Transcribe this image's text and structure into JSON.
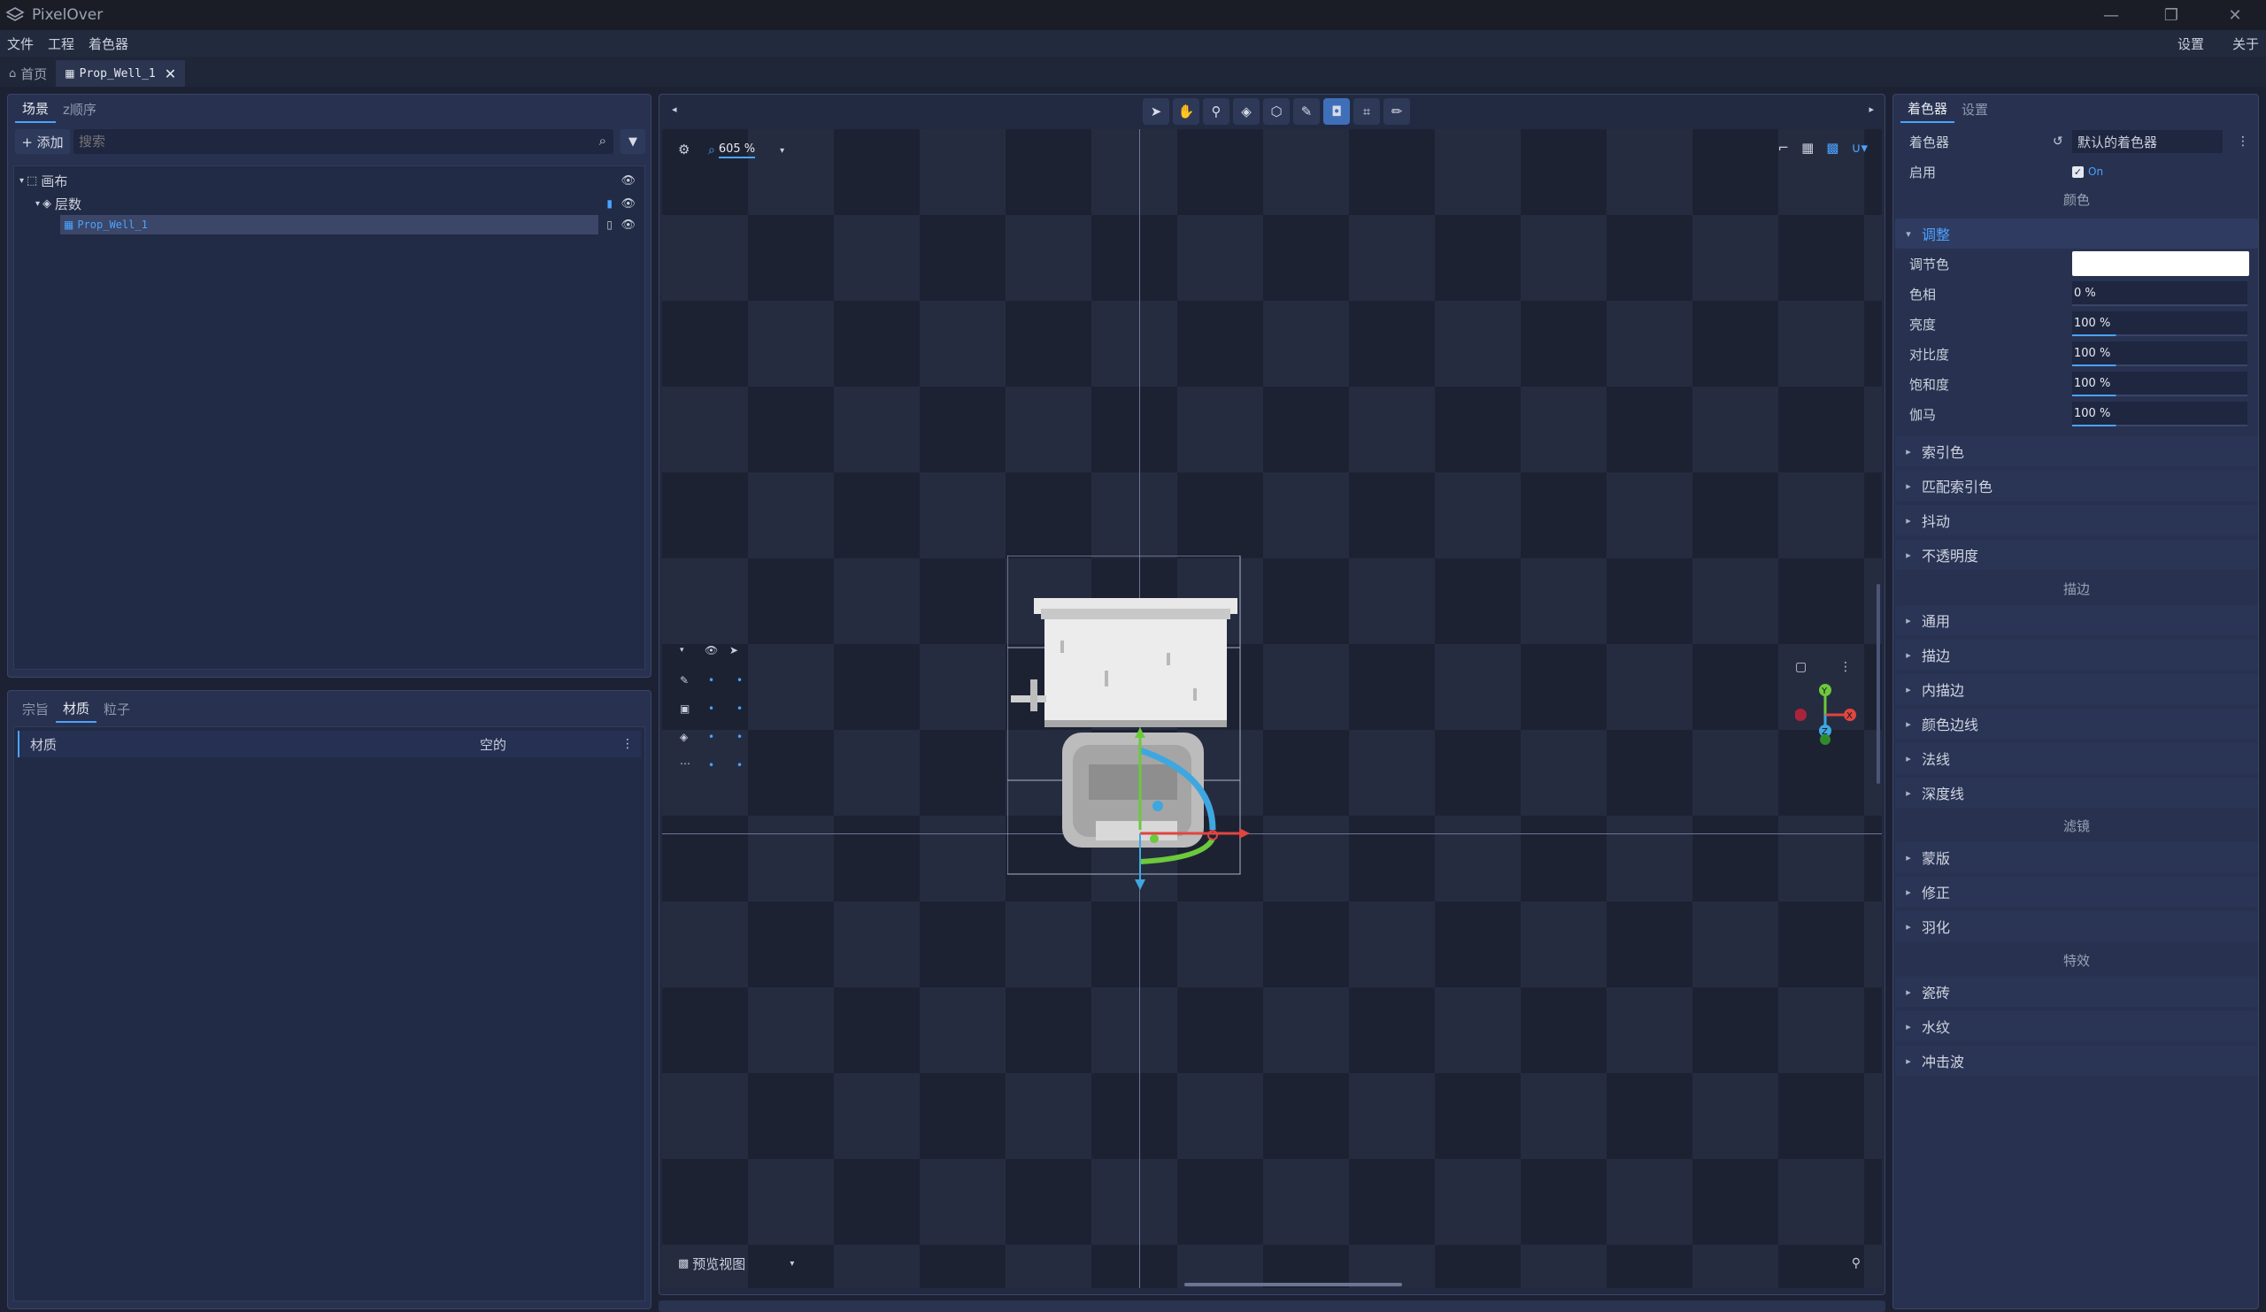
{
  "app": {
    "title": "PixelOver"
  },
  "menu": {
    "items": [
      "文件",
      "工程",
      "着色器"
    ],
    "settings": "设置",
    "about": "关于"
  },
  "tabs": {
    "home": "首页",
    "file": "Prop_Well_1"
  },
  "scene_panel": {
    "tabs": [
      "场景",
      "z顺序"
    ],
    "add_label": "+ 添加",
    "search_placeholder": "搜索",
    "tree": {
      "canvas": "画布",
      "layers": "层数",
      "item": "Prop_Well_1"
    }
  },
  "material_panel": {
    "tabs": [
      "宗旨",
      "材质",
      "粒子"
    ],
    "row_label": "材质",
    "row_value": "空的"
  },
  "viewport": {
    "zoom": "605 %",
    "preview_label": "预览视图",
    "gizmo": {
      "x": "X",
      "y": "Y",
      "z": "Z"
    }
  },
  "shader_panel": {
    "tabs": [
      "着色器",
      "设置"
    ],
    "shader_label": "着色器",
    "shader_value": "默认的着色器",
    "enable_label": "启用",
    "enable_value": "On",
    "group_color": "颜色",
    "adjust": {
      "title": "调整",
      "rows": [
        {
          "label": "调节色",
          "value": ""
        },
        {
          "label": "色相",
          "value": "0 %"
        },
        {
          "label": "亮度",
          "value": "100 %"
        },
        {
          "label": "对比度",
          "value": "100 %"
        },
        {
          "label": "饱和度",
          "value": "100 %"
        },
        {
          "label": "伽马",
          "value": "100 %"
        }
      ]
    },
    "color_sections": [
      "索引色",
      "匹配索引色",
      "抖动",
      "不透明度"
    ],
    "group_outline": "描边",
    "outline_sections": [
      "通用",
      "描边",
      "内描边",
      "颜色边线",
      "法线",
      "深度线"
    ],
    "group_filter": "滤镜",
    "filter_sections": [
      "蒙版",
      "修正",
      "羽化"
    ],
    "group_effect": "特效",
    "effect_sections": [
      "瓷砖",
      "水纹",
      "冲击波"
    ]
  },
  "colors": {
    "accent": "#4aa3ff",
    "active_tool": "#3f6fb8"
  }
}
